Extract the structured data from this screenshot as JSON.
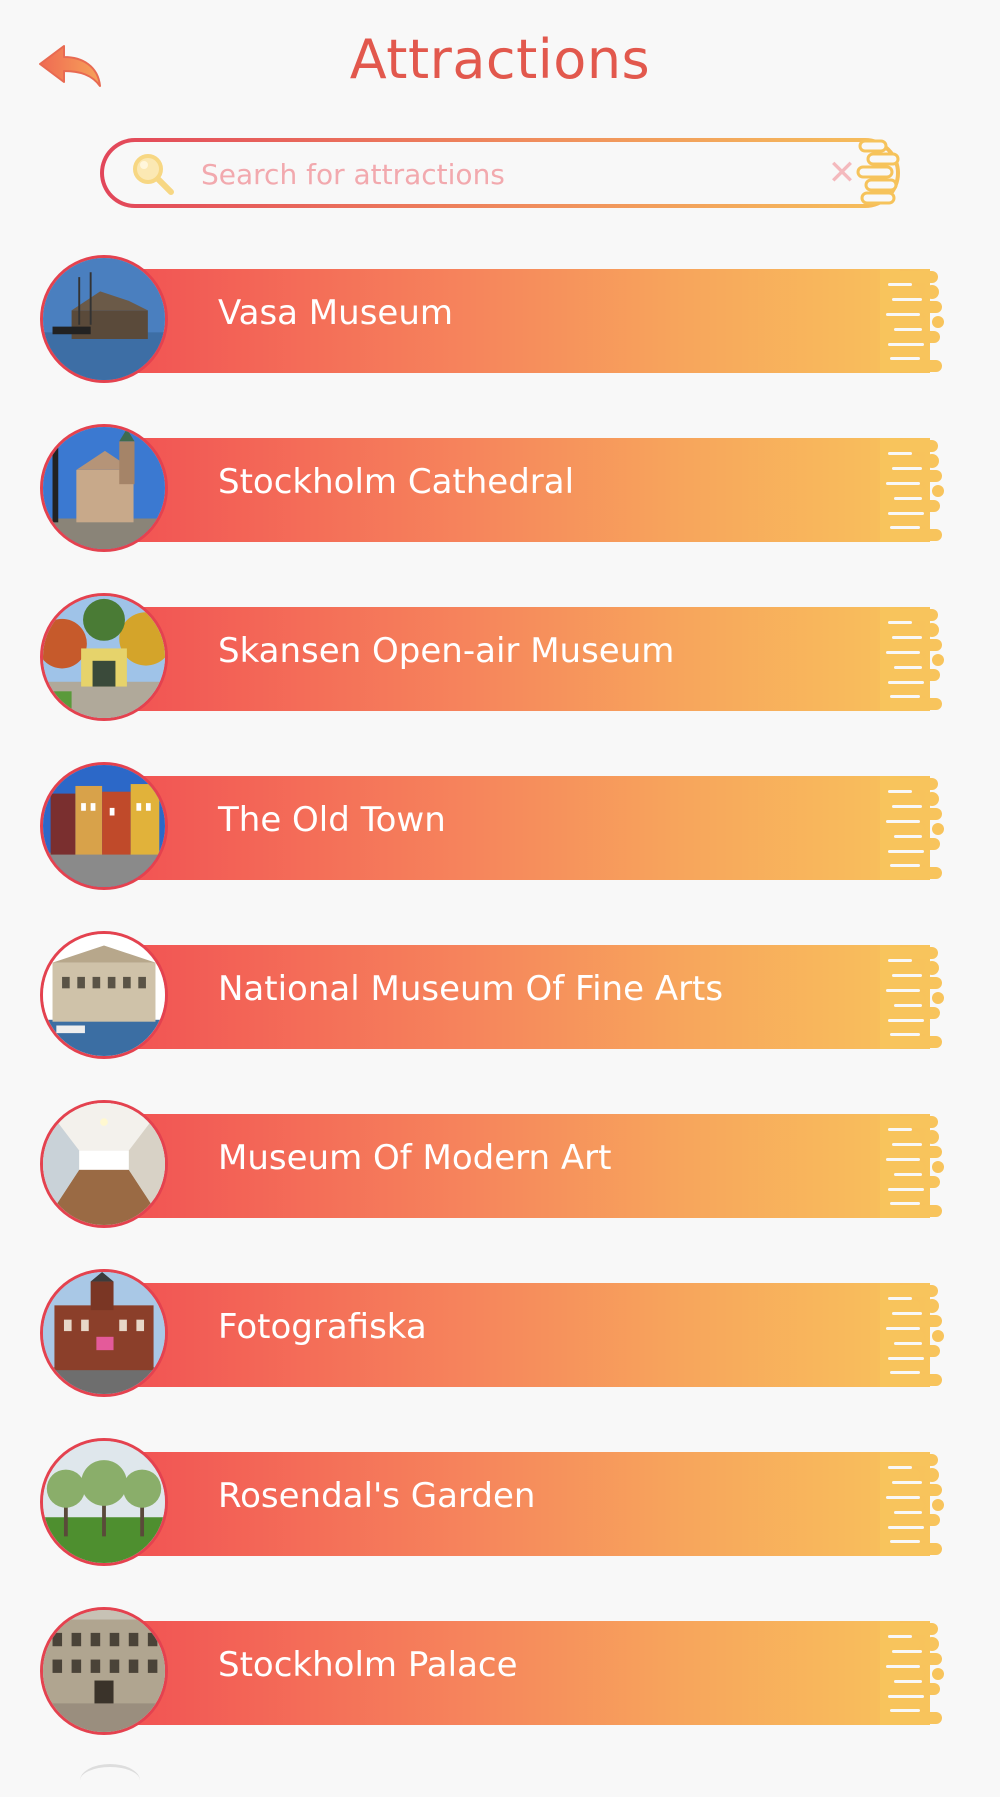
{
  "header": {
    "title": "Attractions"
  },
  "search": {
    "placeholder": "Search for attractions",
    "value": "",
    "clear_label": "✕"
  },
  "attractions": [
    {
      "label": "Vasa Museum",
      "thumb": "ship-museum"
    },
    {
      "label": "Stockholm Cathedral",
      "thumb": "cathedral"
    },
    {
      "label": "Skansen Open-air Museum",
      "thumb": "gate-park"
    },
    {
      "label": "The Old Town",
      "thumb": "colorful-houses"
    },
    {
      "label": "National Museum Of Fine Arts",
      "thumb": "museum-waterfront"
    },
    {
      "label": "Museum Of Modern Art",
      "thumb": "gallery-corridor"
    },
    {
      "label": "Fotografiska",
      "thumb": "brick-building"
    },
    {
      "label": "Rosendal's Garden",
      "thumb": "orchard"
    },
    {
      "label": "Stockholm Palace",
      "thumb": "palace"
    }
  ],
  "colors": {
    "accent": "#e2584d",
    "gradient_start": "#f14f53",
    "gradient_end": "#f8c45c",
    "drip": "#f7c55b"
  }
}
